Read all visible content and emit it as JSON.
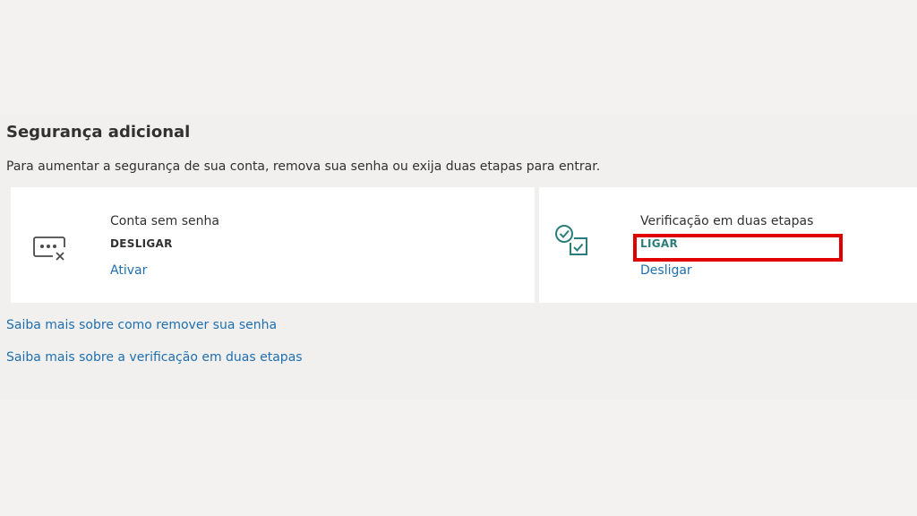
{
  "section": {
    "title": "Segurança adicional",
    "description": "Para aumentar a segurança de sua conta, remova sua senha ou exija duas etapas para entrar."
  },
  "passwordless_card": {
    "icon": "password-off-icon",
    "heading": "Conta sem senha",
    "status": "DESLIGAR",
    "action": "Ativar"
  },
  "two_step_card": {
    "icon": "two-step-check-icon",
    "heading": "Verificação em duas etapas",
    "status": "LIGAR",
    "action": "Desligar"
  },
  "links": {
    "remove_password": "Saiba mais sobre como remover sua senha",
    "two_step": "Saiba mais sobre a verificação em duas etapas"
  },
  "colors": {
    "link": "#1f6fb0",
    "status_on": "#2b7d7a",
    "status_off": "#323130",
    "highlight": "#e00000",
    "icon": "#2b7d7a"
  }
}
